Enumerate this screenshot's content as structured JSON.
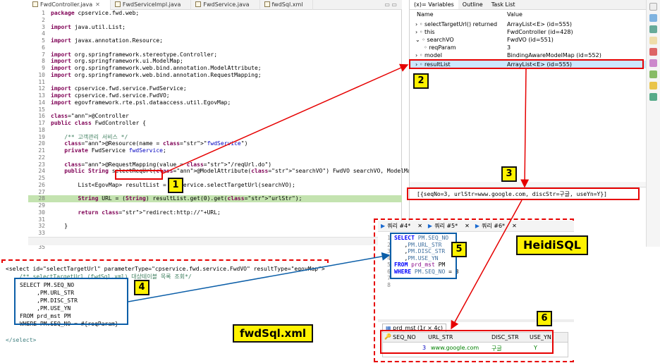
{
  "editor": {
    "tabs": [
      {
        "label": "FwdController.java",
        "active": true
      },
      {
        "label": "FwdServiceImpl.java",
        "active": false
      },
      {
        "label": "FwdService.java",
        "active": false
      },
      {
        "label": "fwdSql.xml",
        "active": false
      }
    ],
    "lines": [
      {
        "n": "1",
        "text": "package cpservice.fwd.web;"
      },
      {
        "n": "2",
        "text": ""
      },
      {
        "n": "3",
        "text": "import java.util.List;"
      },
      {
        "n": "4",
        "text": ""
      },
      {
        "n": "5",
        "text": "import javax.annotation.Resource;"
      },
      {
        "n": "6",
        "text": ""
      },
      {
        "n": "7",
        "text": "import org.springframework.stereotype.Controller;"
      },
      {
        "n": "8",
        "text": "import org.springframework.ui.ModelMap;"
      },
      {
        "n": "9",
        "text": "import org.springframework.web.bind.annotation.ModelAttribute;"
      },
      {
        "n": "10",
        "text": "import org.springframework.web.bind.annotation.RequestMapping;"
      },
      {
        "n": "11",
        "text": ""
      },
      {
        "n": "12",
        "text": "import cpservice.fwd.service.FwdService;"
      },
      {
        "n": "13",
        "text": "import cpservice.fwd.service.FwdVO;"
      },
      {
        "n": "14",
        "text": "import egovframework.rte.psl.dataaccess.util.EgovMap;"
      },
      {
        "n": "15",
        "text": ""
      },
      {
        "n": "16",
        "text": "@Controller"
      },
      {
        "n": "17",
        "text": "public class FwdController {"
      },
      {
        "n": "18",
        "text": ""
      },
      {
        "n": "19",
        "text": "    /** 고객관리 서비스 */"
      },
      {
        "n": "20",
        "text": "    @Resource(name = \"fwdService\")"
      },
      {
        "n": "21",
        "text": "    private FwdService fwdService;"
      },
      {
        "n": "22",
        "text": ""
      },
      {
        "n": "23",
        "text": "    @RequestMapping(value = \"/reqUrl.do\")"
      },
      {
        "n": "24",
        "text": "    public String selectReqUrl(@ModelAttribute(\"searchVO\") FwdVO searchVO, ModelMap model) throws Exception {"
      },
      {
        "n": "25",
        "text": ""
      },
      {
        "n": "26",
        "text": "        List<EgovMap> resultList = fwdService.selectTargetUrl(searchVO);"
      },
      {
        "n": "27",
        "text": ""
      },
      {
        "n": "28",
        "text": "        String URL = (String) resultList.get(0).get(\"urlStr\");"
      },
      {
        "n": "29",
        "text": ""
      },
      {
        "n": "30",
        "text": "        return \"redirect:http://\"+URL;"
      },
      {
        "n": "31",
        "text": ""
      },
      {
        "n": "32",
        "text": "    }"
      },
      {
        "n": "33",
        "text": ""
      },
      {
        "n": "34",
        "text": "}"
      },
      {
        "n": "35",
        "text": ""
      }
    ]
  },
  "variables": {
    "tabs": [
      "(x)= Variables",
      "Outline",
      "Task List"
    ],
    "col_name": "Name",
    "col_value": "Value",
    "rows": [
      {
        "name": "selectTargetUrl() returned",
        "value": "ArrayList<E>  (id=555)"
      },
      {
        "name": "this",
        "value": "FwdController  (id=428)"
      },
      {
        "name": "searchVO",
        "value": "FwdVO  (id=551)"
      },
      {
        "name": "reqParam",
        "value": "3"
      },
      {
        "name": "model",
        "value": "BindingAwareModelMap  (id=552)"
      },
      {
        "name": "resultList",
        "value": "ArrayList<E>  (id=555)"
      }
    ],
    "detail": "[{seqNo=3, urlStr=www.google.com, discStr=구글, useYn=Y}]"
  },
  "heidi": {
    "tabs": [
      "쿼리 #4*",
      "쿼리 #5*",
      "쿼리 #6*"
    ],
    "close": "✕",
    "label": "HeidiSQL",
    "sql": [
      {
        "n": "1",
        "text": "SELECT PM.SEQ_NO"
      },
      {
        "n": "2",
        "text": "   ,PM.URL_STR"
      },
      {
        "n": "3",
        "text": "   ,PM.DISC_STR"
      },
      {
        "n": "4",
        "text": "   ,PM.USE_YN"
      },
      {
        "n": "5",
        "text": "FROM prd_mst PM"
      },
      {
        "n": "6",
        "text": "WHERE PM.SEQ_NO = 3"
      },
      {
        "n": "7",
        "text": ""
      },
      {
        "n": "8",
        "text": ""
      }
    ],
    "result_tab": "prd_mst (1r × 4c)",
    "result_cols": [
      "SEQ_NO",
      "URL_STR",
      "DISC_STR",
      "USE_YN"
    ],
    "result_row": [
      "3",
      "www.google.com",
      "구글",
      "Y"
    ]
  },
  "xml": {
    "line1": "<select id=\"selectTargetUrl\" parameterType=\"cpservice.fwd.service.FwdVO\" resultType=\"egovMap\">",
    "line2": "    /** selectTargetUrl (fwdSql.xml) 대상테이블 목록 조회*/",
    "sql": [
      "SELECT PM.SEQ_NO",
      "     ,PM.URL_STR",
      "     ,PM.DISC_STR",
      "     ,PM.USE_YN",
      "FROM prd_mst PM",
      "WHERE PM.SEQ_NO = #{reqParam}"
    ],
    "close_tag": "</select>",
    "label": "fwdSql.xml"
  },
  "badges": [
    "1",
    "2",
    "3",
    "4",
    "5",
    "6"
  ],
  "colors": {
    "annotation_red": "#e60000",
    "annotation_blue": "#0b5ea8",
    "badge_yellow": "#fff200",
    "debug_line": "#c4e3b0"
  }
}
